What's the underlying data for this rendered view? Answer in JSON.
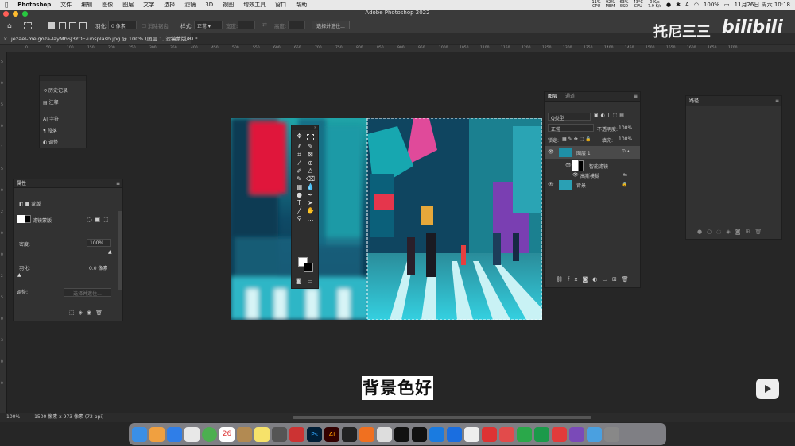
{
  "menubar": {
    "app_name": "Photoshop",
    "items": [
      "文件",
      "编辑",
      "图像",
      "图层",
      "文字",
      "选择",
      "滤镜",
      "3D",
      "视图",
      "增效工具",
      "窗口",
      "帮助"
    ],
    "stats": [
      {
        "top": "11%",
        "bottom": "CPU"
      },
      {
        "top": "92%",
        "bottom": "MEM"
      },
      {
        "top": "63%",
        "bottom": "SSD"
      },
      {
        "top": "43°C",
        "bottom": "CPU"
      },
      {
        "top": "0 K/s",
        "bottom": "7.9 K/s"
      }
    ],
    "battery": "100%",
    "clock": "11月26日 周六 10:18"
  },
  "window": {
    "title": "Adobe Photoshop 2022"
  },
  "options": {
    "feather_label": "羽化:",
    "feather_value": "0 像素",
    "antialias": "消除锯齿",
    "style_label": "样式:",
    "style_value": "正常",
    "width_label": "宽度:",
    "height_label": "高度:",
    "select_mask_button": "选择并遮住..."
  },
  "document": {
    "tab_title": "jezael-melgoza-layMbSJ3YOE-unsplash.jpg @ 100% (图层 1, 滤镜蒙版/8) *"
  },
  "ruler_ticks": [
    "0",
    "50",
    "100",
    "150",
    "200",
    "250",
    "300",
    "350",
    "400",
    "450",
    "500",
    "550",
    "600",
    "650",
    "700",
    "750",
    "800",
    "850",
    "900",
    "950",
    "1000",
    "1050",
    "1100",
    "1150",
    "1200",
    "1250",
    "1300",
    "1350",
    "1400",
    "1450",
    "1500",
    "1550",
    "1600",
    "1650",
    "1700"
  ],
  "vruler_ticks": [
    "5",
    "0",
    "5",
    "0",
    "1",
    "5",
    "0",
    "2",
    "0",
    "0",
    "2",
    "5",
    "0",
    "3",
    "0",
    "0"
  ],
  "history_panel": {
    "items": [
      "历史记录",
      "注释",
      "字符",
      "段落",
      "调整"
    ]
  },
  "properties_panel": {
    "title": "属性",
    "mode": "蒙版",
    "mask_type": "滤镜蒙版",
    "density_label": "密度:",
    "density_value": "100%",
    "feather_label": "羽化:",
    "feather_value": "0.0 像素",
    "refine_label": "调整:",
    "refine_button": "选择并遮住..."
  },
  "layers_panel": {
    "tabs": [
      "图层",
      "通道"
    ],
    "filter_label": "Q类型",
    "blend_mode": "正常",
    "opacity_label": "不透明度:",
    "opacity_value": "100%",
    "lock_label": "锁定:",
    "fill_label": "填充:",
    "fill_value": "100%",
    "layers": [
      {
        "name": "图层 1"
      },
      {
        "name": "智能滤镜"
      },
      {
        "name": "高斯模糊"
      },
      {
        "name": "背景"
      }
    ]
  },
  "paths_panel": {
    "title": "路径"
  },
  "status": {
    "zoom": "100%",
    "dimensions": "1500 像素 x 973 像素 (72 ppi)"
  },
  "watermark": {
    "text": "托尼三三",
    "logo": "bilibili"
  },
  "subtitle": "背景色好",
  "colors": {
    "accent": "#31a8ff",
    "workspace": "#262626",
    "panel": "#323232"
  }
}
